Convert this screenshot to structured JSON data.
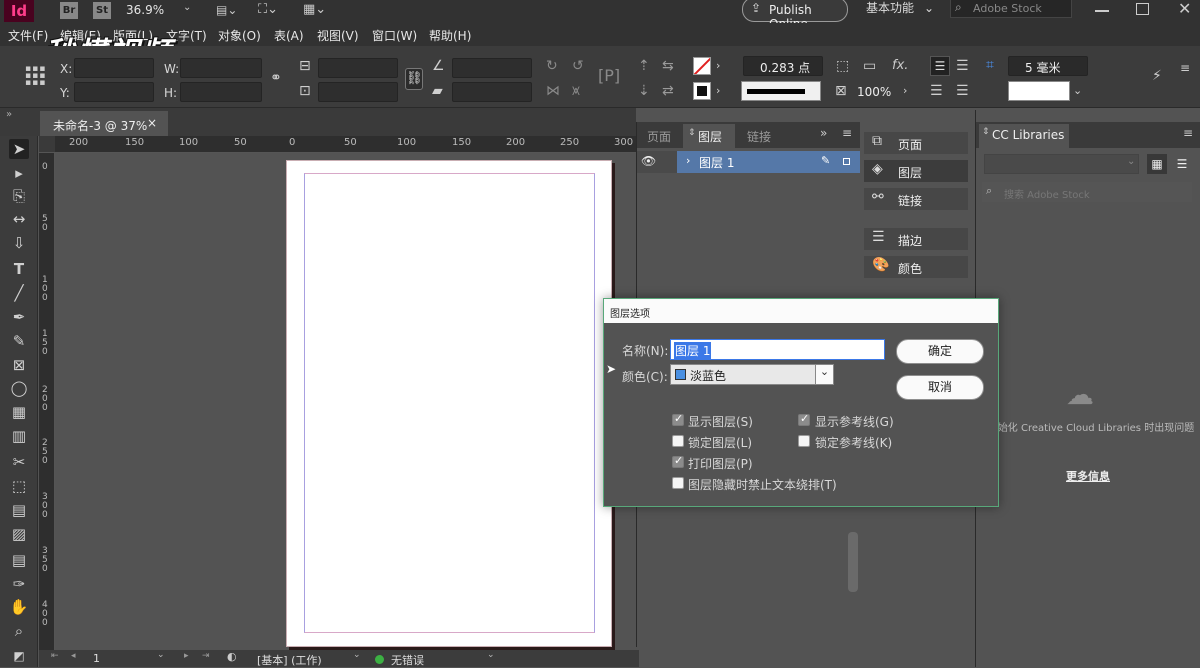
{
  "app": {
    "logo_text": "Id",
    "br": "Br",
    "st": "St",
    "zoom": "36.9%",
    "publish_online": "Publish Online",
    "workspace": "基本功能",
    "search_placeholder": "Adobe Stock"
  },
  "menu": [
    "文件(F)",
    "编辑(E)",
    "版面(L)",
    "文字(T)",
    "对象(O)",
    "表(A)",
    "视图(V)",
    "窗口(W)",
    "帮助(H)"
  ],
  "watermark": "秒懂视频",
  "control": {
    "x_label": "X:",
    "y_label": "Y:",
    "w_label": "W:",
    "h_label": "H:",
    "stroke_weight": "0.283 点",
    "opacity": "100%",
    "offset": "5 毫米",
    "fx": "fx."
  },
  "document": {
    "tab_title": "未命名-3 @ 37%"
  },
  "ruler": {
    "h_labels": [
      "200",
      "150",
      "100",
      "50",
      "0",
      "50",
      "100",
      "150",
      "200",
      "250",
      "300"
    ],
    "v_labels": [
      "0",
      "5\n0",
      "1\n0\n0",
      "1\n5\n0",
      "2\n0\n0",
      "2\n5\n0",
      "3\n0\n0",
      "3\n5\n0",
      "4\n0\n0"
    ]
  },
  "layers_panel": {
    "tabs": [
      "页面",
      "图层",
      "链接"
    ],
    "layer_name": "图层 1"
  },
  "side_panel": {
    "items": [
      "页面",
      "图层",
      "链接",
      "描边",
      "颜色"
    ]
  },
  "cc_libraries": {
    "title": "CC Libraries",
    "search_placeholder": "搜索 Adobe Stock",
    "message": "初始化 Creative Cloud Libraries 时出现问题",
    "more_info": "更多信息"
  },
  "dialog": {
    "title": "图层选项",
    "name_label": "名称(N):",
    "name_value": "图层 1",
    "color_label": "颜色(C):",
    "color_value": "淡蓝色",
    "ok": "确定",
    "cancel": "取消",
    "checkboxes": [
      {
        "label": "显示图层(S)",
        "checked": true
      },
      {
        "label": "显示参考线(G)",
        "checked": true
      },
      {
        "label": "锁定图层(L)",
        "checked": false
      },
      {
        "label": "锁定参考线(K)",
        "checked": false
      },
      {
        "label": "打印图层(P)",
        "checked": true
      },
      {
        "label": "图层隐藏时禁止文本绕排(T)",
        "checked": false
      }
    ]
  },
  "status": {
    "page": "1",
    "master": "[基本] (工作)",
    "preflight": "无错误"
  },
  "colors": {
    "accent": "#4a90e2",
    "layer_color": "#3b78e7",
    "dialog_border": "#58a87a"
  }
}
